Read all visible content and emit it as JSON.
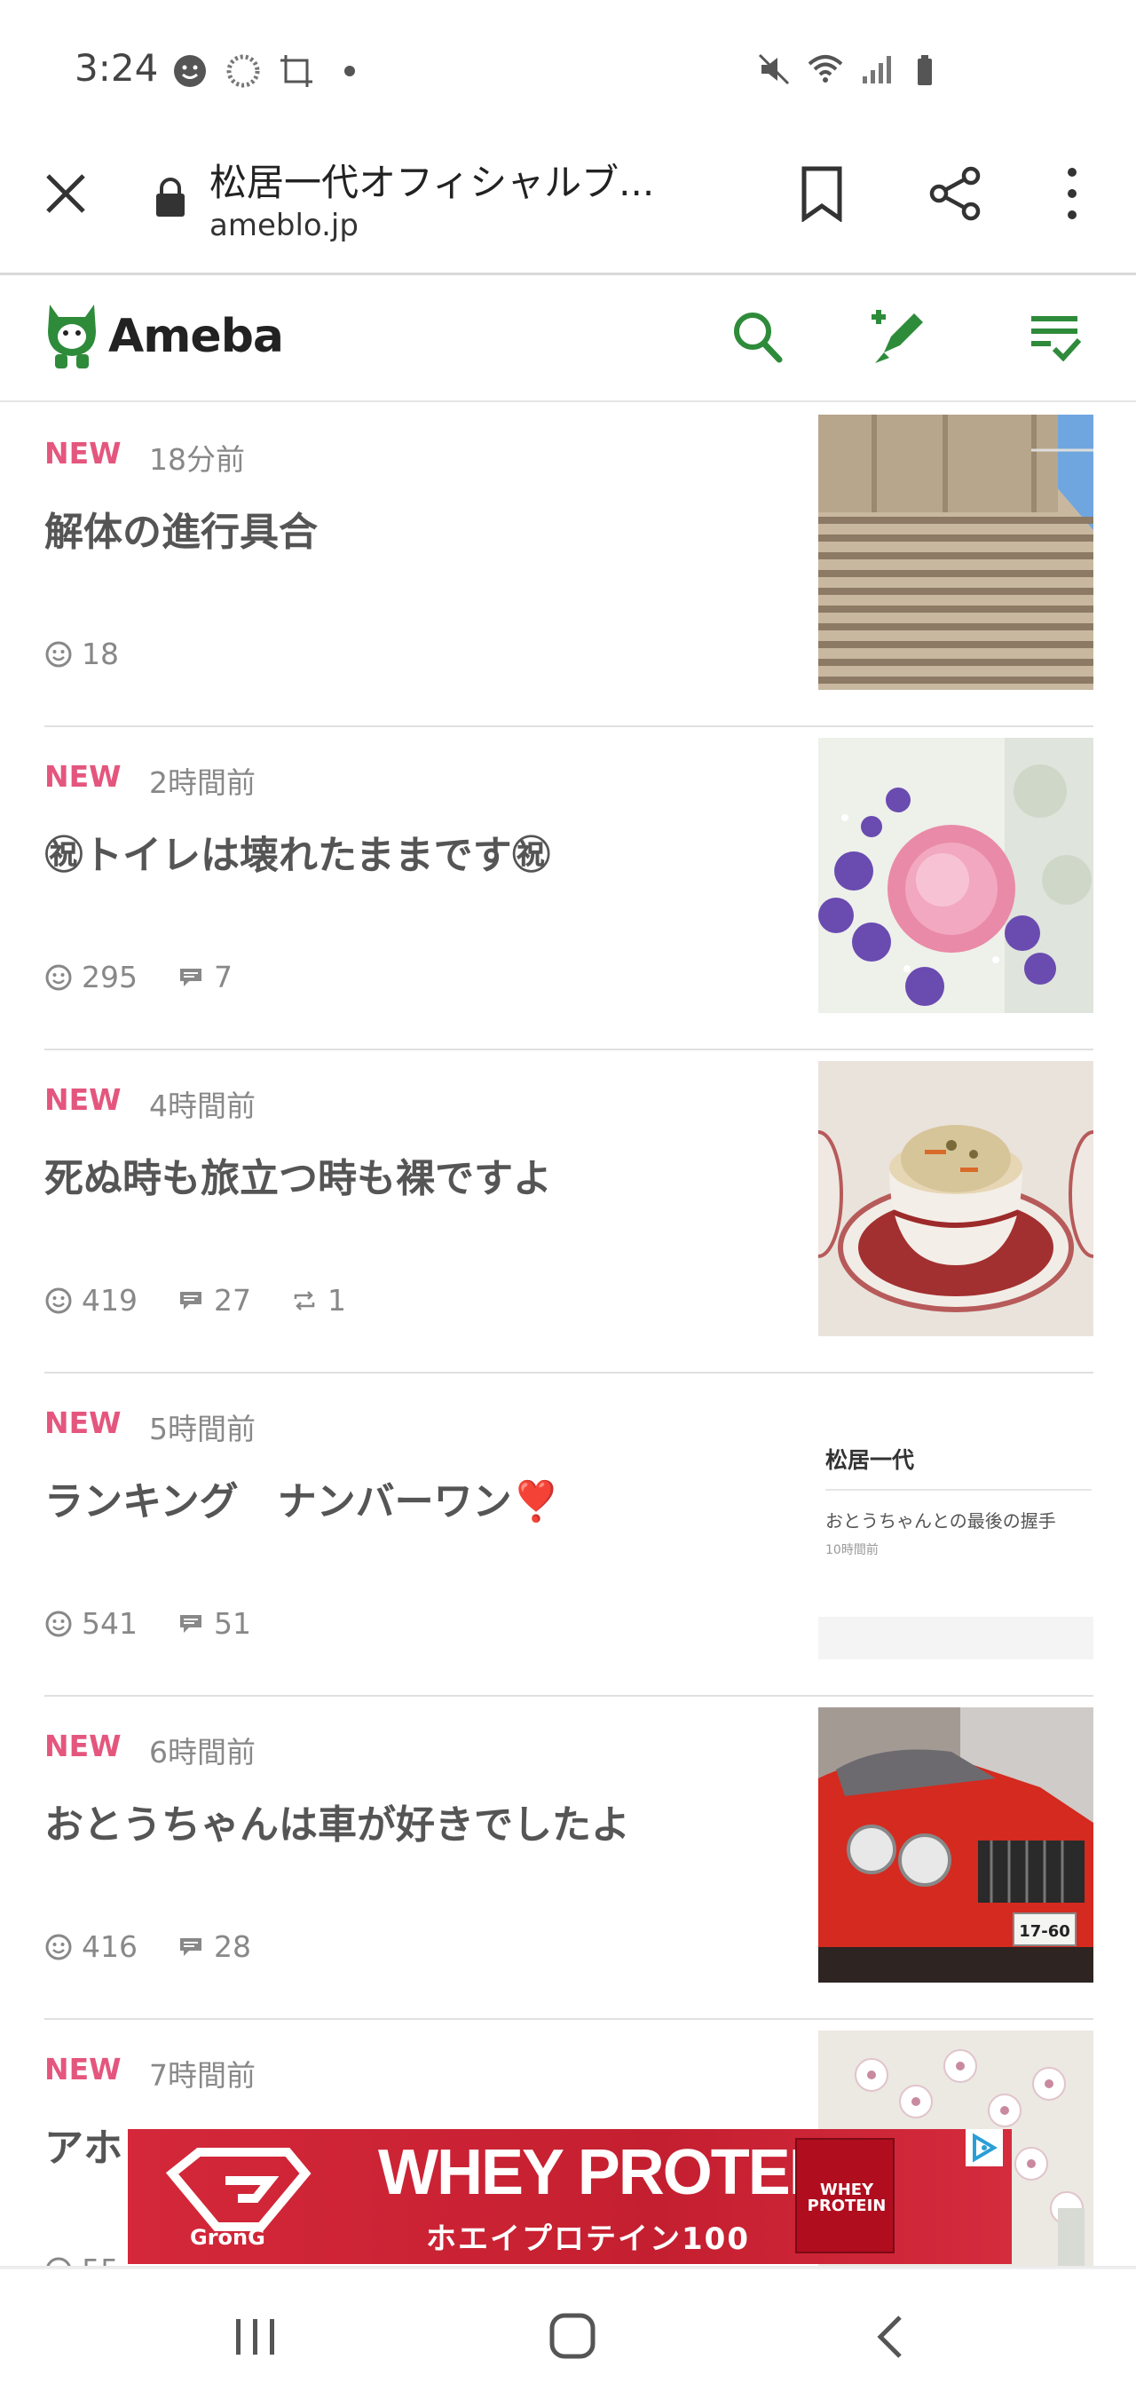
{
  "status_bar": {
    "time": "3:24"
  },
  "browser": {
    "page_title": "松居一代オフィシャルブ...",
    "domain": "ameblo.jp"
  },
  "header": {
    "logo_text": "Ameba",
    "accent_color": "#2e8b3a"
  },
  "entries": [
    {
      "badge": "NEW",
      "time": "18分前",
      "title": "解体の進行具合",
      "likes": "18",
      "comments": "",
      "reblogs": "",
      "thumb": "building-wall"
    },
    {
      "badge": "NEW",
      "time": "2時間前",
      "title": "㊗トイレは壊れたままです㊗",
      "likes": "295",
      "comments": "7",
      "reblogs": "",
      "thumb": "flowers"
    },
    {
      "badge": "NEW",
      "time": "4時間前",
      "title": "死ぬ時も旅立つ時も裸ですよ",
      "likes": "419",
      "comments": "27",
      "reblogs": "1",
      "thumb": "rice-bowl"
    },
    {
      "badge": "NEW",
      "time": "5時間前",
      "title": "ランキング　ナンバーワン❣️",
      "likes": "541",
      "comments": "51",
      "reblogs": "",
      "thumb": "blog-card",
      "card": {
        "author": "松居一代",
        "post": "おとうちゃんとの最後の握手",
        "time": "10時間前"
      }
    },
    {
      "badge": "NEW",
      "time": "6時間前",
      "title": "おとうちゃんは車が好きでしたよ",
      "likes": "416",
      "comments": "28",
      "reblogs": "",
      "thumb": "red-car",
      "plate": "17-60"
    },
    {
      "badge": "NEW",
      "time": "7時間前",
      "title": "アホ",
      "likes": "55",
      "comments": "",
      "reblogs": "",
      "thumb": "orchids"
    }
  ],
  "ad": {
    "brand": "GronG",
    "headline": "WHEY PROTEIN",
    "subline": "ホエイプロテイン100",
    "product_label": "WHEY PROTEIN"
  }
}
